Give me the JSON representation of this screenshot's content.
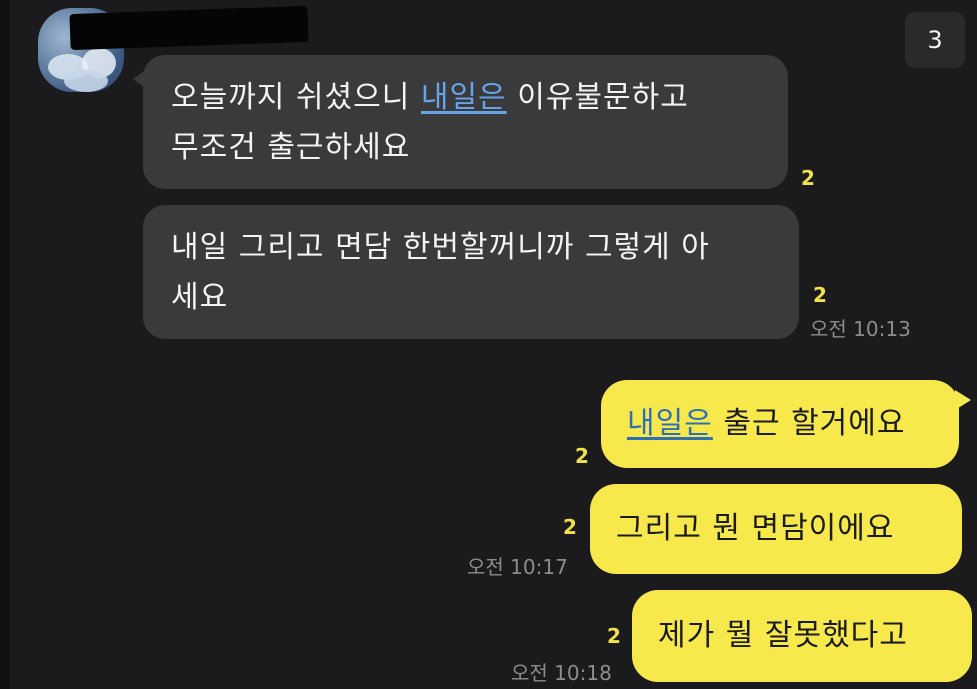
{
  "unread_badge": "3",
  "messages_in": [
    {
      "line1_pre": "오늘까지 쉬셨으니 ",
      "line1_link": "내일은",
      "line1_post": " 이유불문하고",
      "line2": "무조건 출근하세요",
      "unread": "2"
    },
    {
      "line1": "내일 그리고 면담 한번할꺼니까 그렇게 아",
      "line2": "세요",
      "unread": "2",
      "time": "오전 10:13"
    }
  ],
  "messages_out": [
    {
      "link": "내일은",
      "text": " 출근 할거에요",
      "unread": "2"
    },
    {
      "text": "그리고 뭔 면담이에요",
      "unread": "2",
      "time": "오전 10:17"
    },
    {
      "text": "제가 뭘 잘못했다고",
      "unread": "2",
      "time": "오전 10:18"
    }
  ],
  "colors": {
    "background": "#1b1b1d",
    "incoming_bubble": "#3a3a3d",
    "outgoing_bubble": "#f7e94c",
    "unread_count": "#f2e24a",
    "link_incoming": "#68a3e6",
    "link_outgoing": "#2f6fb7"
  }
}
